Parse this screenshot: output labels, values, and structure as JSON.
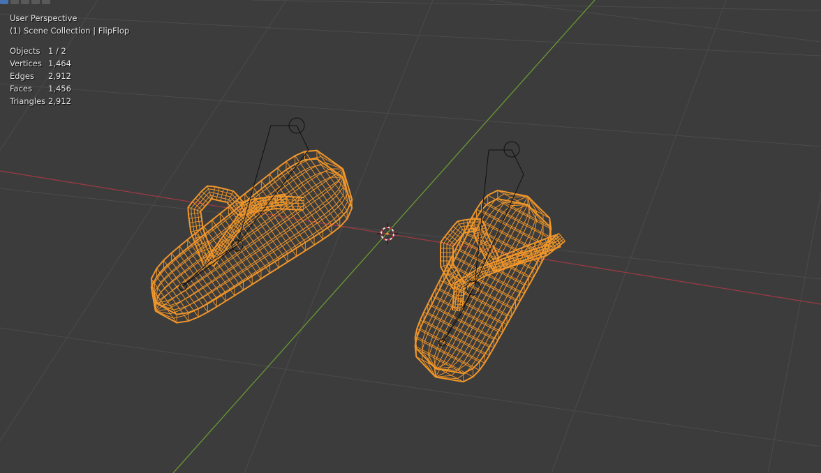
{
  "viewport": {
    "view_name": "User Perspective",
    "collection_info": "(1) Scene Collection | FlipFlop"
  },
  "stats": [
    {
      "label": "Objects",
      "value": "1 / 2"
    },
    {
      "label": "Vertices",
      "value": "1,464"
    },
    {
      "label": "Edges",
      "value": "2,912"
    },
    {
      "label": "Faces",
      "value": "1,456"
    },
    {
      "label": "Triangles",
      "value": "2,912"
    }
  ],
  "colors": {
    "background": "#3c3c3c",
    "grid": "#4a4a4a",
    "x_axis": "#9a3a44",
    "y_axis": "#6a9a32",
    "wire_selected": "#f0962a",
    "armature": "#101010",
    "text": "#e6e6e6"
  },
  "toolbar": {
    "modes": [
      "select-box-icon",
      "select-mode-icon",
      "select-extend-icon",
      "select-subtract-icon",
      "select-intersect-icon"
    ]
  }
}
